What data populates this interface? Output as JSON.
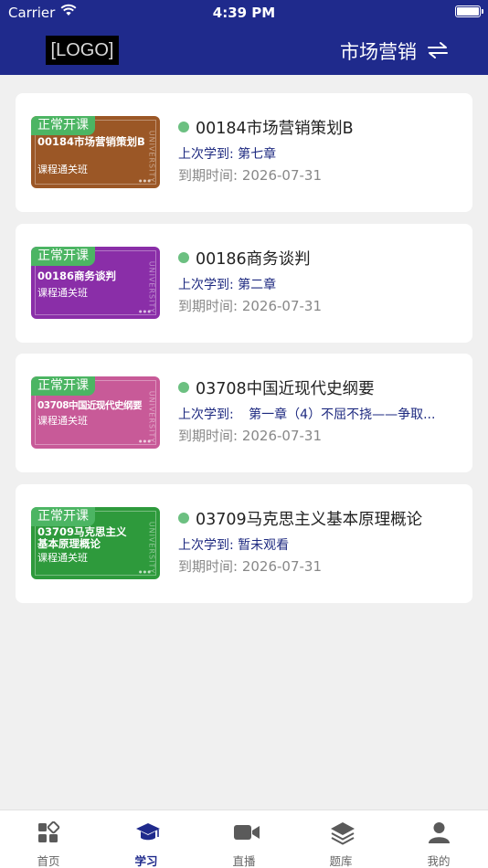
{
  "status_bar": {
    "carrier": "Carrier",
    "time": "4:39 PM"
  },
  "header": {
    "logo_text": "[LOGO]",
    "title": "市场营销"
  },
  "courses": [
    {
      "badge": "正常开课",
      "thumb_title": "00184市场营销策划B",
      "thumb_subtitle": "课程通关班",
      "thumb_color": "#9b5726",
      "title": "00184市场营销策划B",
      "last_label": "上次学到:",
      "last_value": "第七章",
      "expire_label": "到期时间:",
      "expire_value": "2026-07-31"
    },
    {
      "badge": "正常开课",
      "thumb_title": "00186商务谈判",
      "thumb_subtitle": "课程通关班",
      "thumb_color": "#8a2ea8",
      "title": "00186商务谈判",
      "last_label": "上次学到:",
      "last_value": "第二章",
      "expire_label": "到期时间:",
      "expire_value": "2026-07-31"
    },
    {
      "badge": "正常开课",
      "thumb_title": "03708中国近现代史纲要",
      "thumb_subtitle": "课程通关班",
      "thumb_color": "#c85a98",
      "title": "03708中国近现代史纲要",
      "last_label": "上次学到:",
      "last_value": "第一章（4）不屈不挠——争取...",
      "expire_label": "到期时间:",
      "expire_value": "2026-07-31"
    },
    {
      "badge": "正常开课",
      "thumb_title": "03709马克思主义基本原理概论",
      "thumb_subtitle": "课程通关班",
      "thumb_color": "#2e9a3c",
      "title": "03709马克思主义基本原理概论",
      "last_label": "上次学到:",
      "last_value": "暂未观看",
      "expire_label": "到期时间:",
      "expire_value": "2026-07-31"
    }
  ],
  "thumb_vertical_text": "UNIVERSITY",
  "tabbar": [
    {
      "label": "首页",
      "icon": "home-grid-icon",
      "active": false
    },
    {
      "label": "学习",
      "icon": "graduation-cap-icon",
      "active": true
    },
    {
      "label": "直播",
      "icon": "video-camera-icon",
      "active": false
    },
    {
      "label": "题库",
      "icon": "layers-icon",
      "active": false
    },
    {
      "label": "我的",
      "icon": "person-icon",
      "active": false
    }
  ],
  "colors": {
    "header_bg": "#1f2a8c",
    "badge_green": "#4cb563",
    "dot_green": "#6cc081",
    "active_tab": "#1f2a8c"
  }
}
